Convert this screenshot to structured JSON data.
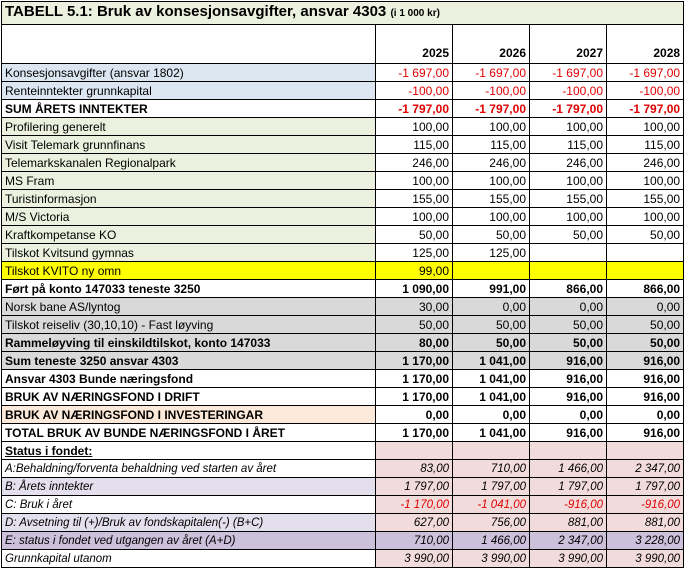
{
  "title": "TABELL 5.1: Bruk av konsesjonsavgifter, ansvar 4303",
  "title_unit": "(i 1 000 kr)",
  "years": [
    "2025",
    "2026",
    "2027",
    "2028"
  ],
  "rows": [
    {
      "label": "Konsesjonsavgifter (ansvar 1802)",
      "v": [
        "-1 697,00",
        "-1 697,00",
        "-1 697,00",
        "-1 697,00"
      ]
    },
    {
      "label": "Renteinntekter grunnkapital",
      "v": [
        "-100,00",
        "-100,00",
        "-100,00",
        "-100,00"
      ]
    },
    {
      "label": "SUM ÅRETS INNTEKTER",
      "v": [
        "-1 797,00",
        "-1 797,00",
        "-1 797,00",
        "-1 797,00"
      ]
    },
    {
      "label": "Profilering generelt",
      "v": [
        "100,00",
        "100,00",
        "100,00",
        "100,00"
      ]
    },
    {
      "label": "Visit Telemark grunnfinans",
      "v": [
        "115,00",
        "115,00",
        "115,00",
        "115,00"
      ]
    },
    {
      "label": "Telemarkskanalen Regionalpark",
      "v": [
        "246,00",
        "246,00",
        "246,00",
        "246,00"
      ]
    },
    {
      "label": "MS Fram",
      "v": [
        "100,00",
        "100,00",
        "100,00",
        "100,00"
      ]
    },
    {
      "label": "Turistinformasjon",
      "v": [
        "155,00",
        "155,00",
        "155,00",
        "155,00"
      ]
    },
    {
      "label": "M/S Victoria",
      "v": [
        "100,00",
        "100,00",
        "100,00",
        "100,00"
      ]
    },
    {
      "label": "Kraftkompetanse KO",
      "v": [
        "50,00",
        "50,00",
        "50,00",
        "50,00"
      ]
    },
    {
      "label": "Tilskot Kvitsund gymnas",
      "v": [
        "125,00",
        "125,00",
        "",
        ""
      ]
    },
    {
      "label": "Tilskot KVITO ny omn",
      "v": [
        "99,00",
        "",
        "",
        ""
      ]
    },
    {
      "label": "Ført på konto 147033 teneste 3250",
      "v": [
        "1 090,00",
        "991,00",
        "866,00",
        "866,00"
      ]
    },
    {
      "label": "Norsk bane AS/lyntog",
      "v": [
        "30,00",
        "0,00",
        "0,00",
        "0,00"
      ]
    },
    {
      "label": "Tilskot reiseliv (30,10,10) - Fast løyving",
      "v": [
        "50,00",
        "50,00",
        "50,00",
        "50,00"
      ]
    },
    {
      "label": "Rammeløyving til einskildtilskot, konto 147033",
      "v": [
        "80,00",
        "50,00",
        "50,00",
        "50,00"
      ]
    },
    {
      "label": "Sum teneste 3250 ansvar 4303",
      "v": [
        "1 170,00",
        "1 041,00",
        "916,00",
        "916,00"
      ]
    },
    {
      "label": " Ansvar 4303 Bunde næringsfond",
      "v": [
        "1 170,00",
        "1 041,00",
        "916,00",
        "916,00"
      ]
    },
    {
      "label": "BRUK AV NÆRINGSFOND I DRIFT",
      "v": [
        "1 170,00",
        "1 041,00",
        "916,00",
        "916,00"
      ]
    },
    {
      "label": "BRUK AV NÆRINGSFOND I INVESTERINGAR",
      "v": [
        "0,00",
        "0,00",
        "0,00",
        "0,00"
      ]
    },
    {
      "label": "TOTAL BRUK AV BUNDE NÆRINGSFOND I ÅRET",
      "v": [
        "1 170,00",
        "1 041,00",
        "916,00",
        "916,00"
      ]
    },
    {
      "label": "Status i fondet:",
      "v": [
        "",
        "",
        "",
        ""
      ]
    },
    {
      "label": "A:Behaldning/forventa behaldning ved starten av året",
      "v": [
        "83,00",
        "710,00",
        "1 466,00",
        "2 347,00"
      ]
    },
    {
      "label": "B:   Årets inntekter",
      "v": [
        "1 797,00",
        "1 797,00",
        "1 797,00",
        "1 797,00"
      ]
    },
    {
      "label": "C: Bruk i året",
      "v": [
        "-1 170,00",
        "-1 041,00",
        "-916,00",
        "-916,00"
      ]
    },
    {
      "label": "D: Avsetning til (+)/Bruk av fondskapitalen(-) (B+C)",
      "v": [
        "627,00",
        "756,00",
        "881,00",
        "881,00"
      ]
    },
    {
      "label": "E: status i fondet ved utgangen av året (A+D)",
      "v": [
        "710,00",
        "1 466,00",
        "2 347,00",
        "3 228,00"
      ]
    },
    {
      "label": "Grunnkapital utanom",
      "v": [
        "3 990,00",
        "3 990,00",
        "3 990,00",
        "3 990,00"
      ]
    }
  ]
}
